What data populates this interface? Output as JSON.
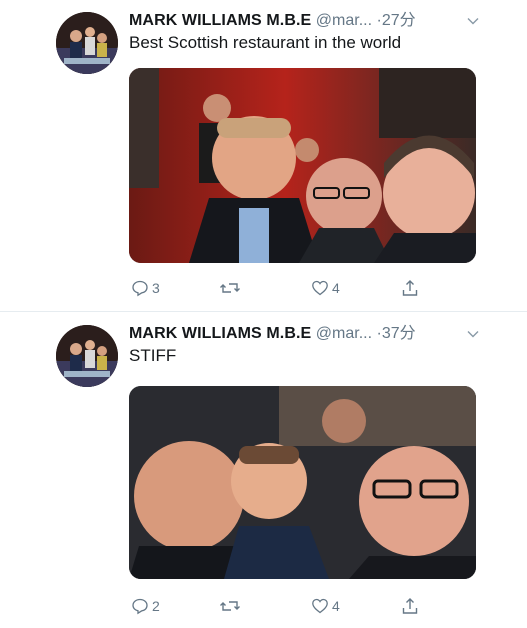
{
  "tweets": [
    {
      "author_name": "MARK WILLIAMS M.B.E",
      "author_handle": "@mar...",
      "separator": "·",
      "time": "27分",
      "text": "Best Scottish restaurant in the world",
      "reply_count": "3",
      "retweet_count": "",
      "like_count": "4"
    },
    {
      "author_name": "MARK WILLIAMS M.B.E",
      "author_handle": "@mar...",
      "separator": "·",
      "time": "37分",
      "text": "STIFF",
      "reply_count": "2",
      "retweet_count": "",
      "like_count": "4"
    }
  ],
  "icons": {
    "reply": "reply-icon",
    "retweet": "retweet-icon",
    "like": "heart-icon",
    "share": "share-icon",
    "more": "chevron-down-icon"
  },
  "colors": {
    "secondary_text": "#657786",
    "primary_text": "#14171a",
    "divider": "#e6ecf0"
  }
}
